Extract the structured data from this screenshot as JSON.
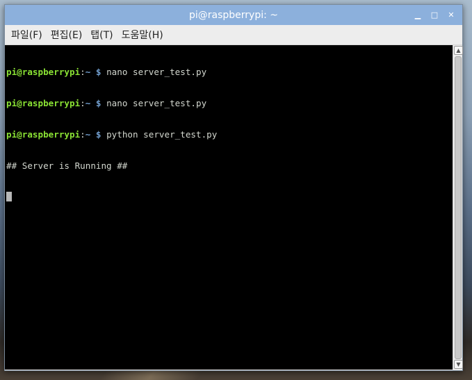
{
  "window": {
    "title": "pi@raspberrypi: ~",
    "controls": {
      "minimize": "▁",
      "maximize": "□",
      "close": "✕"
    }
  },
  "menu": [
    {
      "label": "파일(F)"
    },
    {
      "label": "편집(E)"
    },
    {
      "label": "탭(T)"
    },
    {
      "label": "도움말(H)"
    }
  ],
  "terminal": {
    "prompt_user": "pi@raspberrypi",
    "prompt_sep": ":",
    "prompt_path": "~ ",
    "prompt_dollar": "$",
    "commands": [
      " nano server_test.py",
      " nano server_test.py",
      " python server_test.py"
    ],
    "output": "## Server is Running ##"
  },
  "colors": {
    "title_bar": "#8cb0dc",
    "prompt_user": "#8ae234",
    "prompt_path": "#729fcf",
    "terminal_bg": "#000000",
    "terminal_fg": "#d3d7cf"
  }
}
